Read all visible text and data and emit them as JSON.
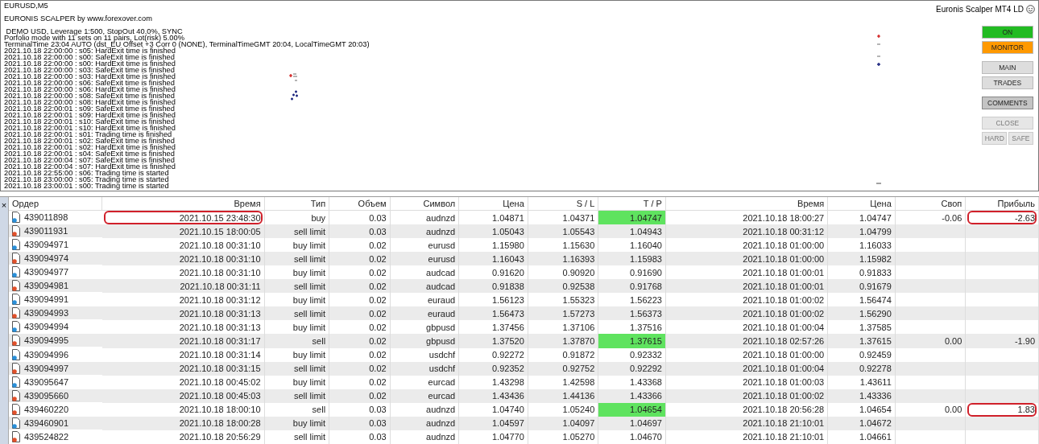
{
  "chart": {
    "symbol": "EURUSD,M5",
    "title": "Euronis Scalper MT4 LD",
    "log": [
      "EURONIS SCALPER by www.forexover.com",
      " DEMO USD, Leverage 1:500, StopOut 40.0%, SYNC",
      "Porfolio mode with 11 sets on 11 pairs, Lot(risk) 5.00%",
      "TerminalTime 23:04 AUTO (dst_EU Offset +3 Corr 0 (NONE), TerminalTimeGMT 20:04, LocalTimeGMT 20:03)",
      "2021.10.18 22:00:00 : s05: HardExit time is finished",
      "2021.10.18 22:00:00 : s00: SafeExit time is finished",
      "2021.10.18 22:00:00 : s00: HardExit time is finished",
      "2021.10.18 22:00:00 : s03: SafeExit time is finished",
      "2021.10.18 22:00:00 : s03: HardExit time is finished",
      "2021.10.18 22:00:00 : s06: SafeExit time is finished",
      "2021.10.18 22:00:00 : s06: HardExit time is finished",
      "2021.10.18 22:00:00 : s08: SafeExit time is finished",
      "2021.10.18 22:00:00 : s08: HardExit time is finished",
      "2021.10.18 22:00:01 : s09: SafeExit time is finished",
      "2021.10.18 22:00:01 : s09: HardExit time is finished",
      "2021.10.18 22:00:01 : s10: SafeExit time is finished",
      "2021.10.18 22:00:01 : s10: HardExit time is finished",
      "2021.10.18 22:00:01 : s01: Trading time is finished",
      "2021.10.18 22:00:01 : s02: SafeExit time is finished",
      "2021.10.18 22:00:01 : s02: HardExit time is finished",
      "2021.10.18 22:00:01 : s04: SafeExit time is finished",
      "2021.10.18 22:00:04 : s07: SafeExit time is finished",
      "2021.10.18 22:00:04 : s07: HardExit time is finished",
      "2021.10.18 22:55:00 : s06: Trading time is started",
      "2021.10.18 23:00:00 : s05: Trading time is started",
      "2021.10.18 23:00:01 : s00: Trading time is started"
    ],
    "button_groups": [
      [
        [
          {
            "label": "ON",
            "color": "#22bb22",
            "pressed": false,
            "disabled": false
          }
        ],
        [
          {
            "label": "MONITOR",
            "color": "#ff9900",
            "pressed": false,
            "disabled": false
          }
        ]
      ],
      [
        [
          {
            "label": "MAIN",
            "pressed": false,
            "disabled": false
          }
        ],
        [
          {
            "label": "TRADES",
            "pressed": false,
            "disabled": false
          }
        ]
      ],
      [
        [
          {
            "label": "COMMENTS",
            "pressed": true,
            "disabled": false
          }
        ]
      ],
      [
        [
          {
            "label": "CLOSE",
            "pressed": false,
            "disabled": true
          }
        ],
        [
          {
            "label": "HARD",
            "pressed": false,
            "disabled": true
          },
          {
            "label": "SAFE",
            "pressed": false,
            "disabled": true
          }
        ]
      ]
    ]
  },
  "terminal": {
    "close": "×",
    "columns": [
      "Ордер",
      "Время",
      "Тип",
      "Объем",
      "Символ",
      "Цена",
      "S / L",
      "T / P",
      "Время",
      "Цена",
      "Своп",
      "Прибыль"
    ],
    "rows": [
      {
        "kind": "buy",
        "cells": [
          "439011898",
          "2021.10.15 23:48:30",
          "buy",
          "0.03",
          "audnzd",
          "1.04871",
          "1.04371",
          "1.04747",
          "2021.10.18 18:00:27",
          "1.04747",
          "-0.06",
          "-2.63"
        ],
        "tp_hit": true,
        "time_circled": true,
        "profit_circled": true
      },
      {
        "kind": "sell",
        "cells": [
          "439011931",
          "2021.10.15 18:00:05",
          "sell limit",
          "0.03",
          "audnzd",
          "1.05043",
          "1.05543",
          "1.04943",
          "2021.10.18 00:31:12",
          "1.04799",
          "",
          ""
        ],
        "tp_hit": false,
        "time_circled": false,
        "profit_circled": false
      },
      {
        "kind": "buy",
        "cells": [
          "439094971",
          "2021.10.18 00:31:10",
          "buy limit",
          "0.02",
          "eurusd",
          "1.15980",
          "1.15630",
          "1.16040",
          "2021.10.18 01:00:00",
          "1.16033",
          "",
          ""
        ],
        "tp_hit": false,
        "time_circled": false,
        "profit_circled": false
      },
      {
        "kind": "sell",
        "cells": [
          "439094974",
          "2021.10.18 00:31:10",
          "sell limit",
          "0.02",
          "eurusd",
          "1.16043",
          "1.16393",
          "1.15983",
          "2021.10.18 01:00:00",
          "1.15982",
          "",
          ""
        ],
        "tp_hit": false,
        "time_circled": false,
        "profit_circled": false
      },
      {
        "kind": "buy",
        "cells": [
          "439094977",
          "2021.10.18 00:31:10",
          "buy limit",
          "0.02",
          "audcad",
          "0.91620",
          "0.90920",
          "0.91690",
          "2021.10.18 01:00:01",
          "0.91833",
          "",
          ""
        ],
        "tp_hit": false,
        "time_circled": false,
        "profit_circled": false
      },
      {
        "kind": "sell",
        "cells": [
          "439094981",
          "2021.10.18 00:31:11",
          "sell limit",
          "0.02",
          "audcad",
          "0.91838",
          "0.92538",
          "0.91768",
          "2021.10.18 01:00:01",
          "0.91679",
          "",
          ""
        ],
        "tp_hit": false,
        "time_circled": false,
        "profit_circled": false
      },
      {
        "kind": "buy",
        "cells": [
          "439094991",
          "2021.10.18 00:31:12",
          "buy limit",
          "0.02",
          "euraud",
          "1.56123",
          "1.55323",
          "1.56223",
          "2021.10.18 01:00:02",
          "1.56474",
          "",
          ""
        ],
        "tp_hit": false,
        "time_circled": false,
        "profit_circled": false
      },
      {
        "kind": "sell",
        "cells": [
          "439094993",
          "2021.10.18 00:31:13",
          "sell limit",
          "0.02",
          "euraud",
          "1.56473",
          "1.57273",
          "1.56373",
          "2021.10.18 01:00:02",
          "1.56290",
          "",
          ""
        ],
        "tp_hit": false,
        "time_circled": false,
        "profit_circled": false
      },
      {
        "kind": "buy",
        "cells": [
          "439094994",
          "2021.10.18 00:31:13",
          "buy limit",
          "0.02",
          "gbpusd",
          "1.37456",
          "1.37106",
          "1.37516",
          "2021.10.18 01:00:04",
          "1.37585",
          "",
          ""
        ],
        "tp_hit": false,
        "time_circled": false,
        "profit_circled": false
      },
      {
        "kind": "sell",
        "cells": [
          "439094995",
          "2021.10.18 00:31:17",
          "sell",
          "0.02",
          "gbpusd",
          "1.37520",
          "1.37870",
          "1.37615",
          "2021.10.18 02:57:26",
          "1.37615",
          "0.00",
          "-1.90"
        ],
        "tp_hit": true,
        "time_circled": false,
        "profit_circled": false
      },
      {
        "kind": "buy",
        "cells": [
          "439094996",
          "2021.10.18 00:31:14",
          "buy limit",
          "0.02",
          "usdchf",
          "0.92272",
          "0.91872",
          "0.92332",
          "2021.10.18 01:00:00",
          "0.92459",
          "",
          ""
        ],
        "tp_hit": false,
        "time_circled": false,
        "profit_circled": false
      },
      {
        "kind": "sell",
        "cells": [
          "439094997",
          "2021.10.18 00:31:15",
          "sell limit",
          "0.02",
          "usdchf",
          "0.92352",
          "0.92752",
          "0.92292",
          "2021.10.18 01:00:04",
          "0.92278",
          "",
          ""
        ],
        "tp_hit": false,
        "time_circled": false,
        "profit_circled": false
      },
      {
        "kind": "buy",
        "cells": [
          "439095647",
          "2021.10.18 00:45:02",
          "buy limit",
          "0.02",
          "eurcad",
          "1.43298",
          "1.42598",
          "1.43368",
          "2021.10.18 01:00:03",
          "1.43611",
          "",
          ""
        ],
        "tp_hit": false,
        "time_circled": false,
        "profit_circled": false
      },
      {
        "kind": "sell",
        "cells": [
          "439095660",
          "2021.10.18 00:45:03",
          "sell limit",
          "0.02",
          "eurcad",
          "1.43436",
          "1.44136",
          "1.43366",
          "2021.10.18 01:00:02",
          "1.43336",
          "",
          ""
        ],
        "tp_hit": false,
        "time_circled": false,
        "profit_circled": false
      },
      {
        "kind": "sell",
        "cells": [
          "439460220",
          "2021.10.18 18:00:10",
          "sell",
          "0.03",
          "audnzd",
          "1.04740",
          "1.05240",
          "1.04654",
          "2021.10.18 20:56:28",
          "1.04654",
          "0.00",
          "1.83"
        ],
        "tp_hit": true,
        "time_circled": false,
        "profit_circled": true
      },
      {
        "kind": "buy",
        "cells": [
          "439460901",
          "2021.10.18 18:00:28",
          "buy limit",
          "0.03",
          "audnzd",
          "1.04597",
          "1.04097",
          "1.04697",
          "2021.10.18 21:10:01",
          "1.04672",
          "",
          ""
        ],
        "tp_hit": false,
        "time_circled": false,
        "profit_circled": false
      },
      {
        "kind": "sell",
        "cells": [
          "439524822",
          "2021.10.18 20:56:29",
          "sell limit",
          "0.03",
          "audnzd",
          "1.04770",
          "1.05270",
          "1.04670",
          "2021.10.18 21:10:01",
          "1.04661",
          "",
          ""
        ],
        "tp_hit": false,
        "time_circled": false,
        "profit_circled": false
      }
    ]
  }
}
